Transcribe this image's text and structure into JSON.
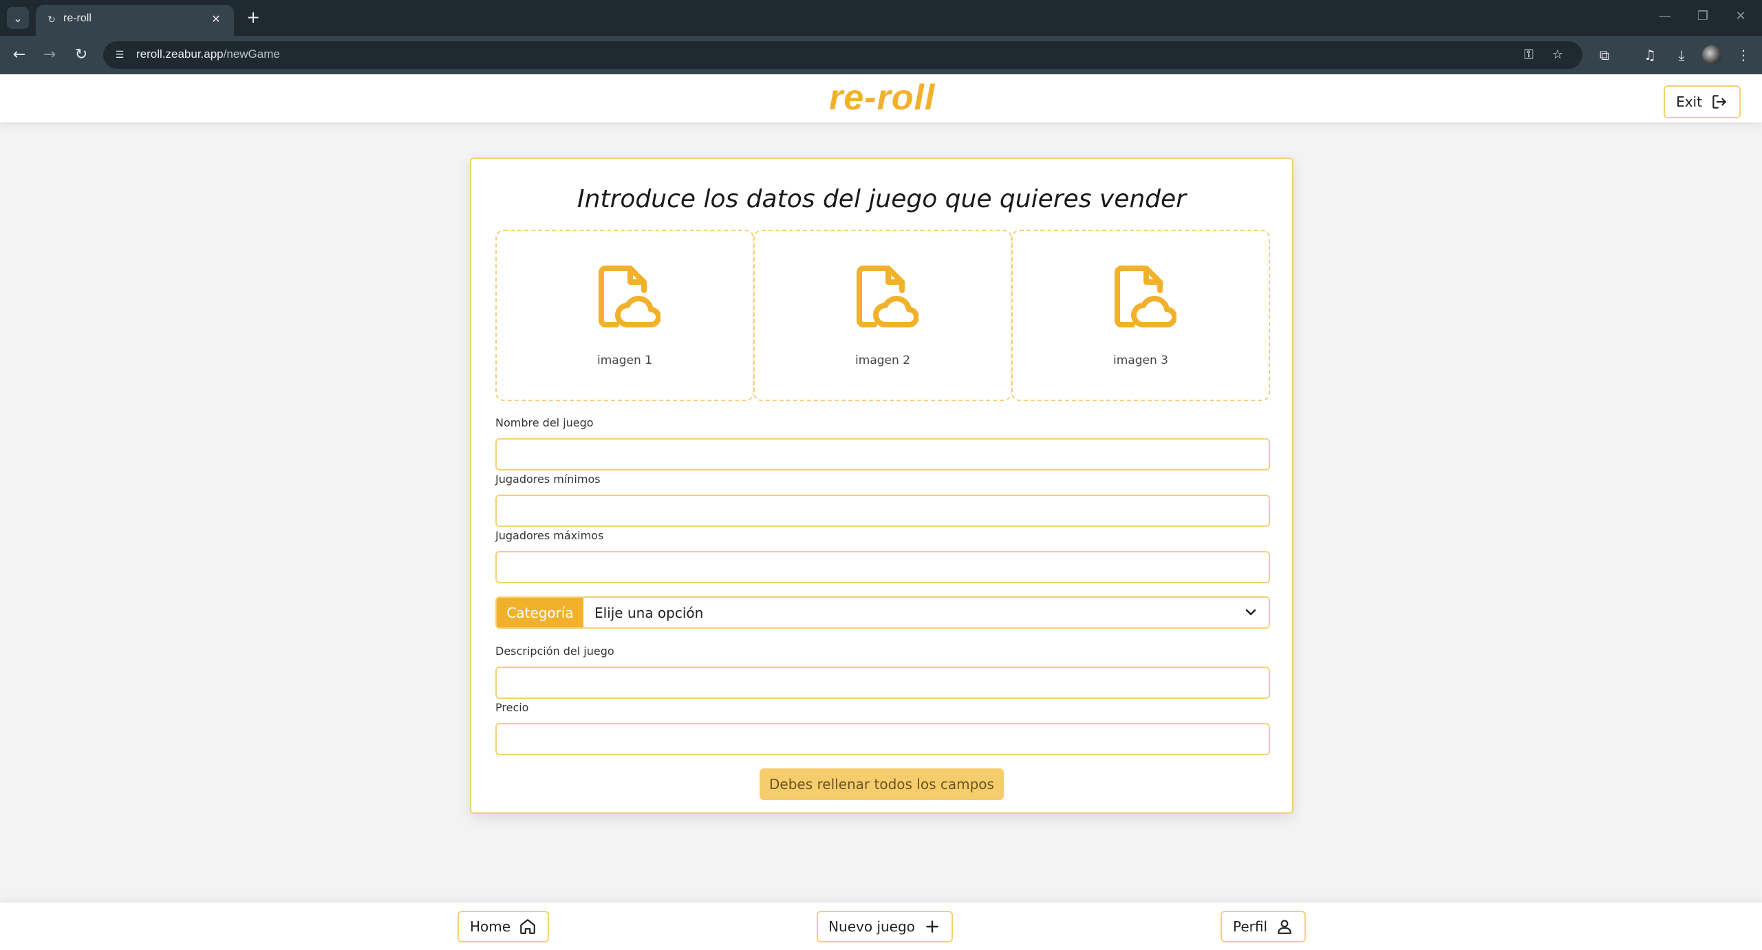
{
  "browser": {
    "tab_title": "re-roll",
    "url_host": "reroll.zeabur.app",
    "url_path": "/newGame"
  },
  "header": {
    "brand": "re-roll",
    "exit_label": "Exit"
  },
  "form": {
    "title": "Introduce los datos del juego que quieres vender",
    "images": [
      {
        "label": "imagen 1"
      },
      {
        "label": "imagen 2"
      },
      {
        "label": "imagen 3"
      }
    ],
    "fields": {
      "name_label": "Nombre del juego",
      "min_players_label": "Jugadores mínimos",
      "max_players_label": "Jugadores máximos",
      "description_label": "Descripción del juego",
      "price_label": "Precio"
    },
    "category": {
      "addon": "Categoría",
      "selected": "Elije una opción"
    },
    "submit_label": "Debes rellenar todos los campos"
  },
  "bottom_nav": {
    "home": "Home",
    "new_game": "Nuevo juego",
    "profile": "Perfil"
  },
  "colors": {
    "accent": "#f2b12b",
    "border": "#f5cf78",
    "disabled_button": "#f6cd6c"
  }
}
